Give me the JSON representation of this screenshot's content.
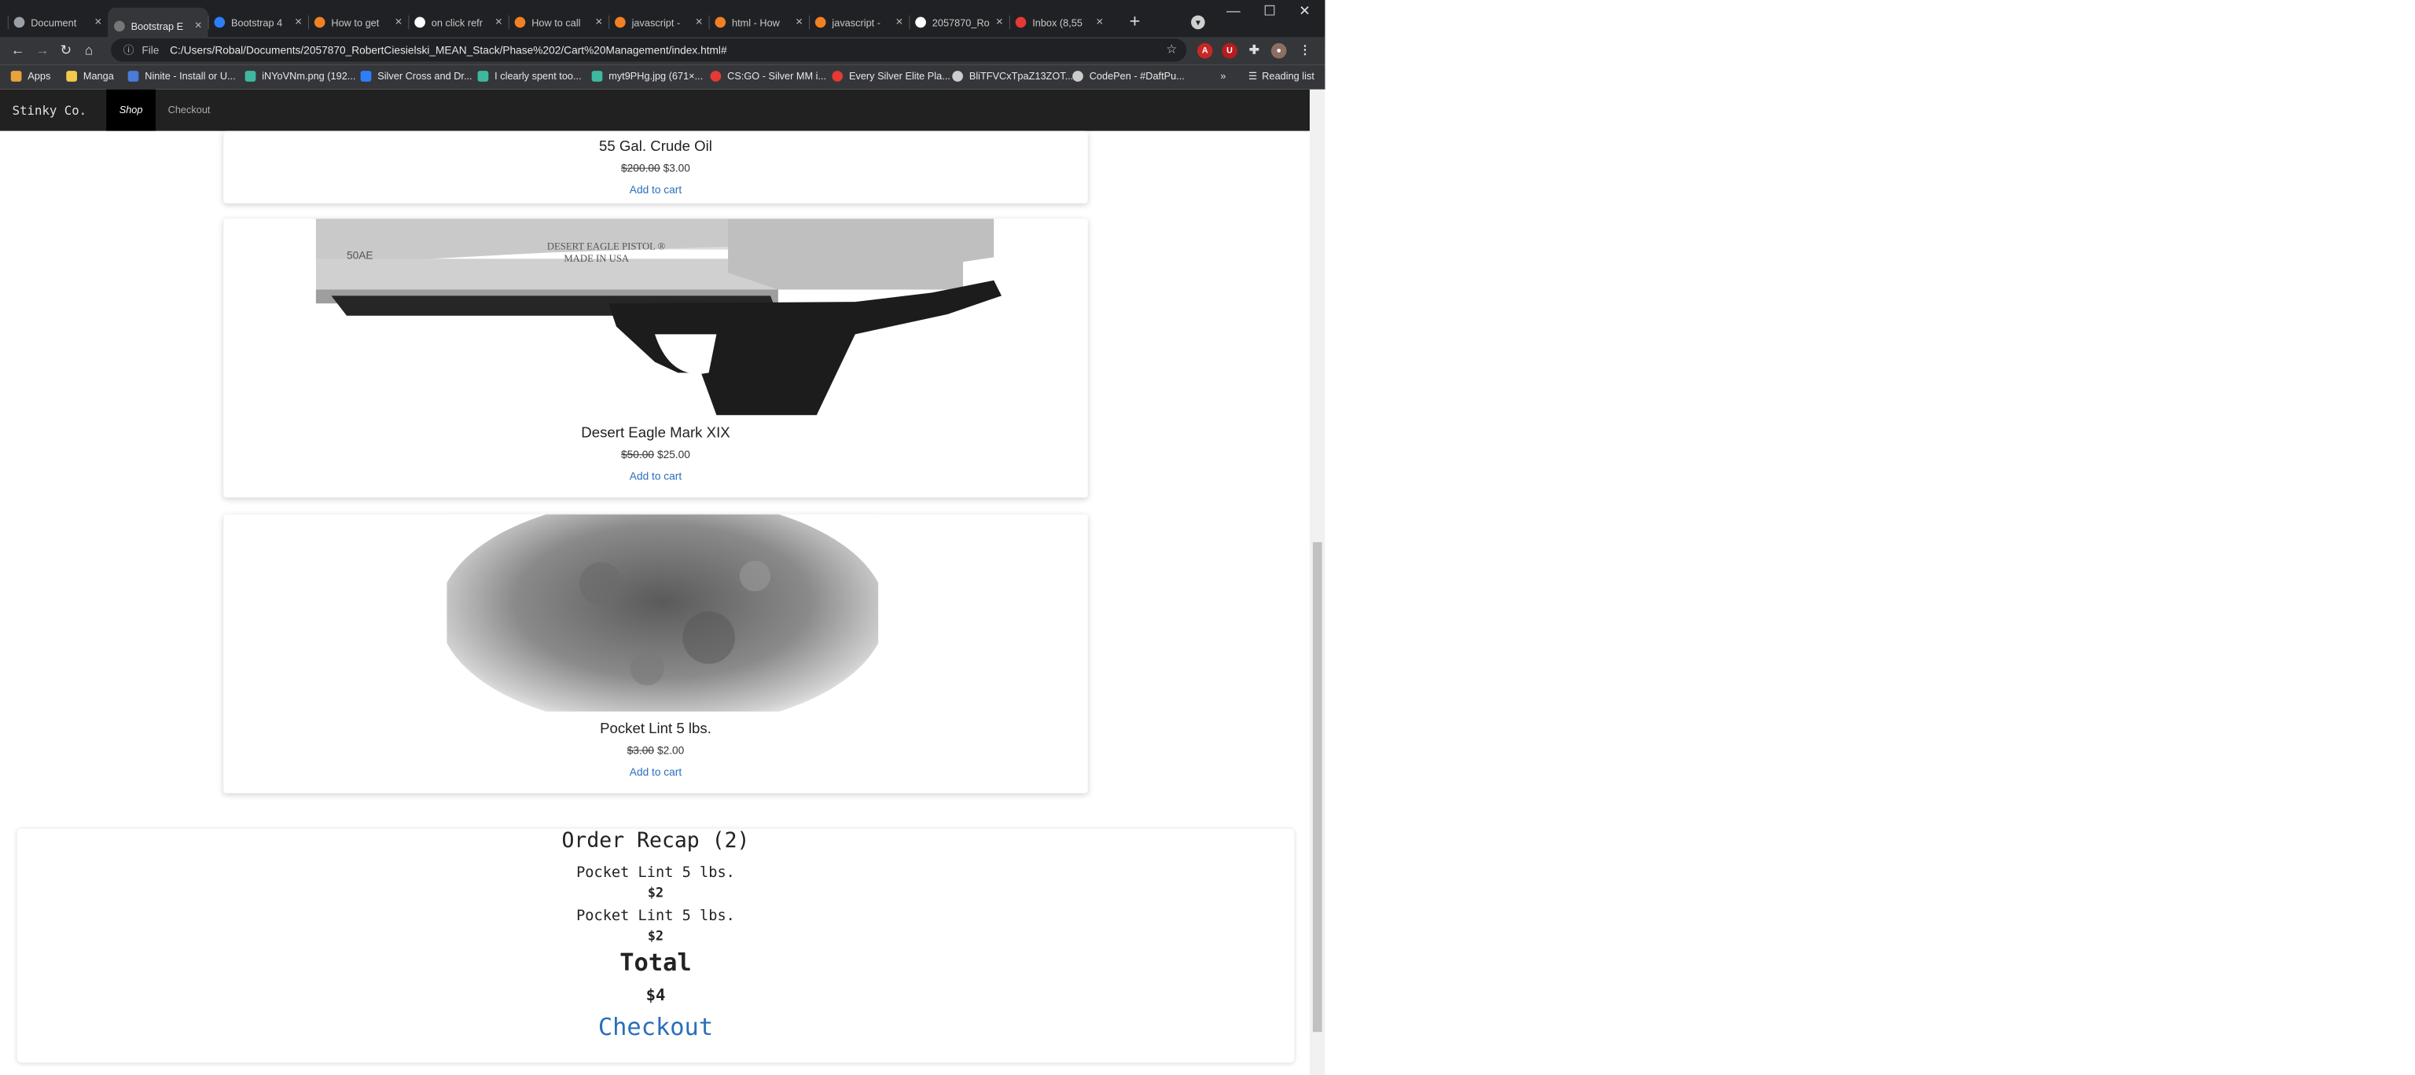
{
  "browser": {
    "tabs": [
      {
        "title": "Document"
      },
      {
        "title": "Bootstrap E"
      },
      {
        "title": "Bootstrap 4"
      },
      {
        "title": "How to get"
      },
      {
        "title": "on click refr"
      },
      {
        "title": "How to call"
      },
      {
        "title": "javascript -"
      },
      {
        "title": "html - How"
      },
      {
        "title": "javascript -"
      },
      {
        "title": "2057870_Ro"
      },
      {
        "title": "Inbox (8,55"
      }
    ],
    "address": {
      "scheme_label": "File",
      "url": "C:/Users/Robal/Documents/2057870_RobertCiesielski_MEAN_Stack/Phase%202/Cart%20Management/index.html#"
    },
    "bookmarks": [
      {
        "label": "Apps",
        "color": "#e8a33d"
      },
      {
        "label": "Manga",
        "color": "#f2c94c"
      },
      {
        "label": "Ninite - Install or U...",
        "color": "#4a7bd8"
      },
      {
        "label": "iNYoVNm.png (192...",
        "color": "#3fb8a0"
      },
      {
        "label": "Silver Cross and Dr...",
        "color": "#2d7ff9"
      },
      {
        "label": "I clearly spent too...",
        "color": "#3fb8a0"
      },
      {
        "label": "myt9PHg.jpg (671×...",
        "color": "#3fb8a0"
      },
      {
        "label": "CS:GO - Silver MM i...",
        "color": "#e53935"
      },
      {
        "label": "Every Silver Elite Pla...",
        "color": "#e53935"
      },
      {
        "label": "BliTFVCxTpaZ13ZOT...",
        "color": "#cccccc"
      },
      {
        "label": "CodePen - #DaftPu...",
        "color": "#cccccc"
      }
    ],
    "reading_list": "Reading list"
  },
  "navbar": {
    "brand": "Stinky Co.",
    "shop": "Shop",
    "checkout": "Checkout"
  },
  "products": [
    {
      "name": "55 Gal. Crude Oil",
      "old_price": "$200.00",
      "price": "$3.00",
      "action": "Add to cart"
    },
    {
      "name": "Desert Eagle Mark XIX",
      "old_price": "$50.00",
      "price": "$25.00",
      "action": "Add to cart"
    },
    {
      "name": "Pocket Lint 5 lbs.",
      "old_price": "$3.00",
      "price": "$2.00",
      "action": "Add to cart"
    }
  ],
  "gun_imprint": {
    "model": "50AE",
    "line1": "DESERT EAGLE PISTOL ®",
    "line2": "MADE IN USA"
  },
  "recap": {
    "title": "Order Recap (2)",
    "items": [
      {
        "name": "Pocket Lint 5 lbs.",
        "price": "$2"
      },
      {
        "name": "Pocket Lint 5 lbs.",
        "price": "$2"
      }
    ],
    "total_label": "Total",
    "total_value": "$4",
    "checkout": "Checkout"
  },
  "colors": {
    "chrome_dark": "#202124",
    "chrome_toolbar": "#35363a",
    "navbar": "#212121",
    "link": "#2a6ebb"
  }
}
